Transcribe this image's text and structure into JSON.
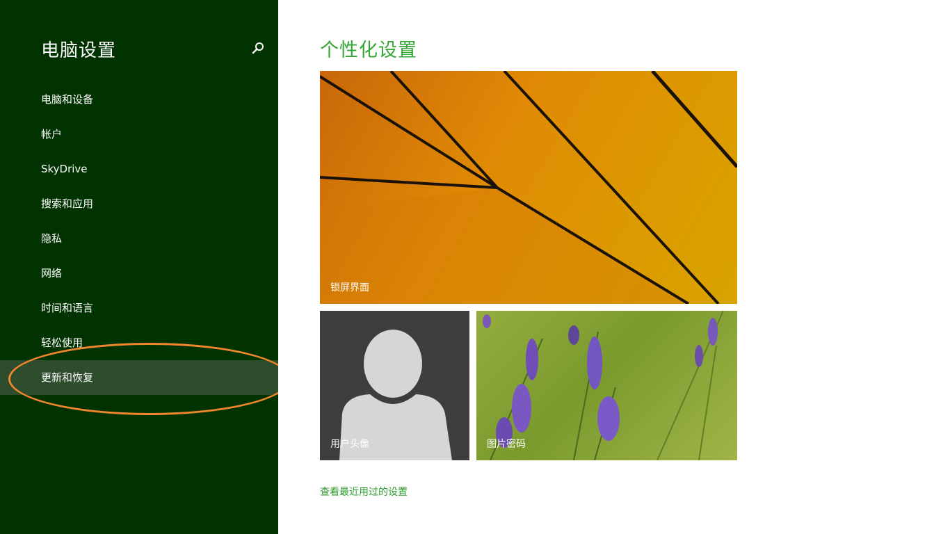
{
  "sidebar": {
    "title": "电脑设置",
    "search_icon": "search-icon",
    "items": [
      {
        "label": "电脑和设备"
      },
      {
        "label": "帐户"
      },
      {
        "label": "SkyDrive"
      },
      {
        "label": "搜索和应用"
      },
      {
        "label": "隐私"
      },
      {
        "label": "网络"
      },
      {
        "label": "时间和语言"
      },
      {
        "label": "轻松使用"
      },
      {
        "label": "更新和恢复"
      }
    ],
    "selected_index": 8
  },
  "main": {
    "title": "个性化设置",
    "tiles": {
      "lock_screen": {
        "label": "锁屏界面"
      },
      "account_picture": {
        "label": "用户头像"
      },
      "picture_password": {
        "label": "图片密码"
      }
    },
    "recent_link": "查看最近用过的设置"
  },
  "colors": {
    "sidebar_bg": "#003300",
    "selected_bg": "#2d4d2d",
    "accent": "#35a535",
    "annotation": "#f2862d"
  }
}
